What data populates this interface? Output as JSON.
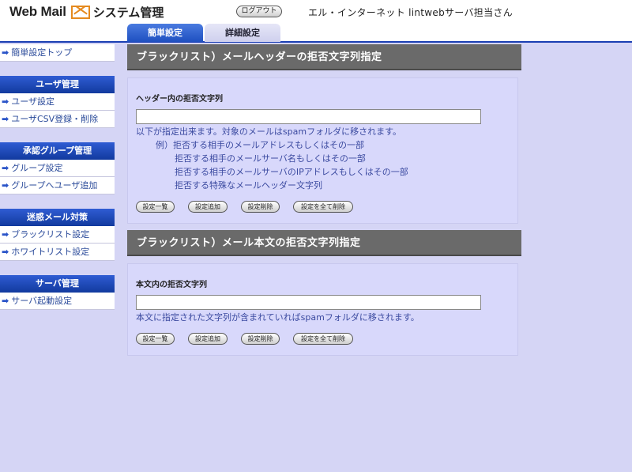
{
  "header": {
    "logo_text": "Web Mail",
    "system_title": "システム管理",
    "logout_label": "ログアウト",
    "user_name": "エル・インターネット lintwebサーバ担当さん"
  },
  "tabs": [
    {
      "label": "簡単設定",
      "active": true
    },
    {
      "label": "詳細設定",
      "active": false
    }
  ],
  "sidebar": {
    "top_link": "簡単設定トップ",
    "groups": [
      {
        "heading": "ユーザ管理",
        "links": [
          "ユーザ設定",
          "ユーザCSV登録・削除"
        ]
      },
      {
        "heading": "承認グループ管理",
        "links": [
          "グループ設定",
          "グループへユーザ追加"
        ]
      },
      {
        "heading": "迷惑メール対策",
        "links": [
          "ブラックリスト設定",
          "ホワイトリスト設定"
        ]
      },
      {
        "heading": "サーバ管理",
        "links": [
          "サーバ起動設定"
        ]
      }
    ]
  },
  "section1": {
    "title": "ブラックリスト）メールヘッダーの拒否文字列指定",
    "field_label": "ヘッダー内の拒否文字列",
    "input_value": "",
    "note": "以下が指定出来ます。対象のメールはspamフォルダに移されます。",
    "example_lines": [
      "例）拒否する相手のメールアドレスもしくはその一部",
      "拒否する相手のメールサーバ名もしくはその一部",
      "拒否する相手のメールサーバのIPアドレスもしくはその一部",
      "拒否する特殊なメールヘッダー文字列"
    ],
    "buttons": [
      "設定一覧",
      "設定追加",
      "設定削除",
      "設定を全て削除"
    ]
  },
  "section2": {
    "title": "ブラックリスト）メール本文の拒否文字列指定",
    "field_label": "本文内の拒否文字列",
    "input_value": "",
    "note": "本文に指定された文字列が含まれていればspamフォルダに移されます。",
    "buttons": [
      "設定一覧",
      "設定追加",
      "設定削除",
      "設定を全て削除"
    ]
  },
  "colors": {
    "background": "#d5d5f5",
    "nav_blue": "#1e4fc0",
    "section_header": "#6a6a6a",
    "link_text": "#2a4a9a",
    "logo_accent": "#e58a1f"
  }
}
